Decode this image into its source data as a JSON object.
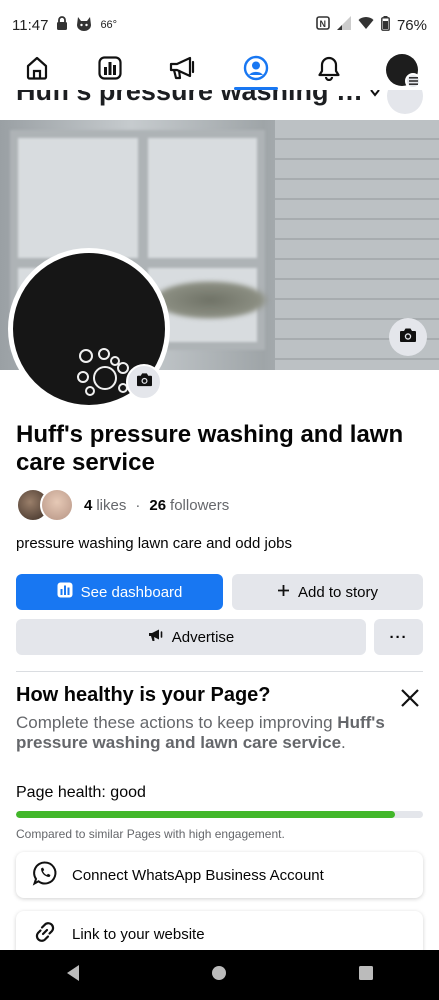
{
  "status_bar": {
    "time": "11:47",
    "temperature": "66°",
    "battery": "76%"
  },
  "nav": {
    "items": [
      "home-icon",
      "insights-icon",
      "megaphone-icon",
      "profile-icon",
      "bell-icon",
      "avatar"
    ],
    "active": "profile-icon",
    "accent_color": "#1877f2"
  },
  "sticky_header": {
    "title": "Huff's pressure washing an..."
  },
  "page": {
    "name": "Huff's pressure washing and lawn care service",
    "likes_count": "4",
    "likes_label": "likes",
    "separator": "·",
    "followers_count": "26",
    "followers_label": "followers",
    "bio": "pressure washing lawn care and odd jobs"
  },
  "actions": {
    "dashboard_label": "See dashboard",
    "story_label": "Add to story",
    "advertise_label": "Advertise",
    "more_label": "···",
    "primary_color": "#1877f2"
  },
  "health": {
    "title": "How healthy is your Page?",
    "desc_prefix": "Complete these actions to keep improving ",
    "desc_page_name": "Huff's pressure washing and lawn care service",
    "desc_suffix": ".",
    "status": "Page health:  good",
    "progress_fraction": 0.93,
    "bar_color": "#42b72a",
    "compare_text": "Compared to similar Pages with high engagement."
  },
  "suggestions": [
    {
      "label": "Connect WhatsApp Business Account",
      "icon": "whatsapp-icon"
    },
    {
      "label": "Link to your website",
      "icon": "link-icon"
    }
  ]
}
